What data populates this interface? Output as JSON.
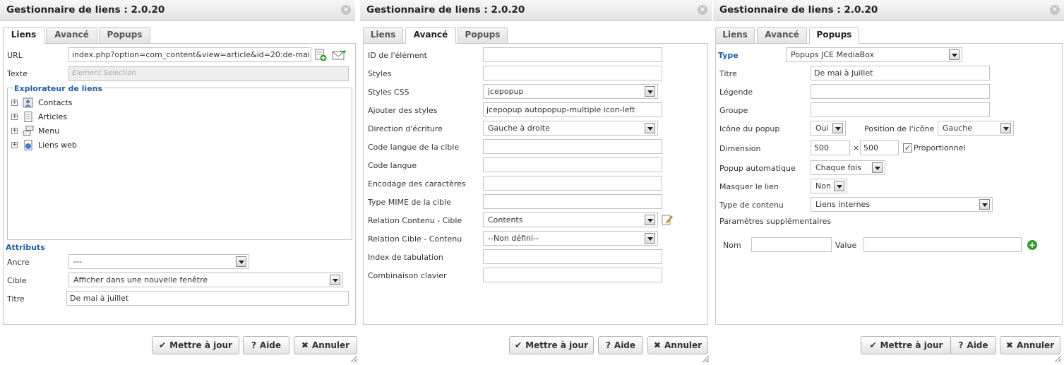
{
  "dialog_title": "Gestionnaire de liens : 2.0.20",
  "close_glyph": "×",
  "tabs": [
    "Liens",
    "Avancé",
    "Popups"
  ],
  "buttons": {
    "update": "Mettre à jour",
    "help": "Aide",
    "cancel": "Annuler"
  },
  "button_glyphs": {
    "update": "✔",
    "help": "?",
    "cancel": "✖"
  },
  "liens": {
    "url_label": "URL",
    "url_value": "index.php?option=com_content&view=article&id=20:de-mai",
    "texte_label": "Texte",
    "texte_placeholder": "Element Selection",
    "browser_title": "Explorateur de liens",
    "tree": [
      {
        "label": "Contacts",
        "icon": "contacts-icon"
      },
      {
        "label": "Articles",
        "icon": "articles-icon"
      },
      {
        "label": "Menu",
        "icon": "menu-icon"
      },
      {
        "label": "Liens web",
        "icon": "web-links-icon"
      }
    ],
    "attributs_title": "Attributs",
    "ancre_label": "Ancre",
    "ancre_value": "---",
    "cible_label": "Cible",
    "cible_value": "Afficher dans une nouvelle fenêtre",
    "titre_label": "Titre",
    "titre_value": "De mai à juillet"
  },
  "avance": {
    "id_label": "ID de l'élément",
    "styles_label": "Styles",
    "styles_css_label": "Styles CSS",
    "styles_css_value": "jcepopup",
    "ajouter_label": "Ajouter des styles",
    "ajouter_value": "jcepopup autopopup-multiple icon-left",
    "direction_label": "Direction d'écriture",
    "direction_value": "Gauche à droite",
    "code_langue_cible_label": "Code langue de la cible",
    "code_langue_label": "Code langue",
    "encodage_label": "Encodage des caractères",
    "mime_label": "Type MIME de la cible",
    "rel_label": "Relation Contenu - Cible",
    "rel_value": "Contents",
    "rev_label": "Relation Cible - Contenu",
    "rev_value": "--Non défini--",
    "tabindex_label": "Index de tabulation",
    "accesskey_label": "Combinaison clavier"
  },
  "popups": {
    "type_label": "Type",
    "type_value": "Popups JCE MediaBox",
    "titre_label": "Titre",
    "titre_value": "De mai à Juillet",
    "legende_label": "Légende",
    "groupe_label": "Groupe",
    "icone_label": "Icône du popup",
    "icone_value": "Oui",
    "position_label": "Position de l'icône",
    "position_value": "Gauche",
    "dimension_label": "Dimension",
    "width_value": "500",
    "times": "×",
    "height_value": "500",
    "proportionnel_label": "Proportionnel",
    "proportionnel_checked": "✓",
    "auto_label": "Popup automatique",
    "auto_value": "Chaque fois",
    "masquer_label": "Masquer le lien",
    "masquer_value": "Non",
    "contenu_label": "Type de contenu",
    "contenu_value": "Liens internes",
    "params_label": "Paramètres supplémentaires",
    "nom_label": "Nom",
    "value_label": "Value",
    "add_glyph": "+"
  },
  "colors": {
    "section_blue": "#1f5fa8",
    "add_green": "#2e9a2e"
  }
}
